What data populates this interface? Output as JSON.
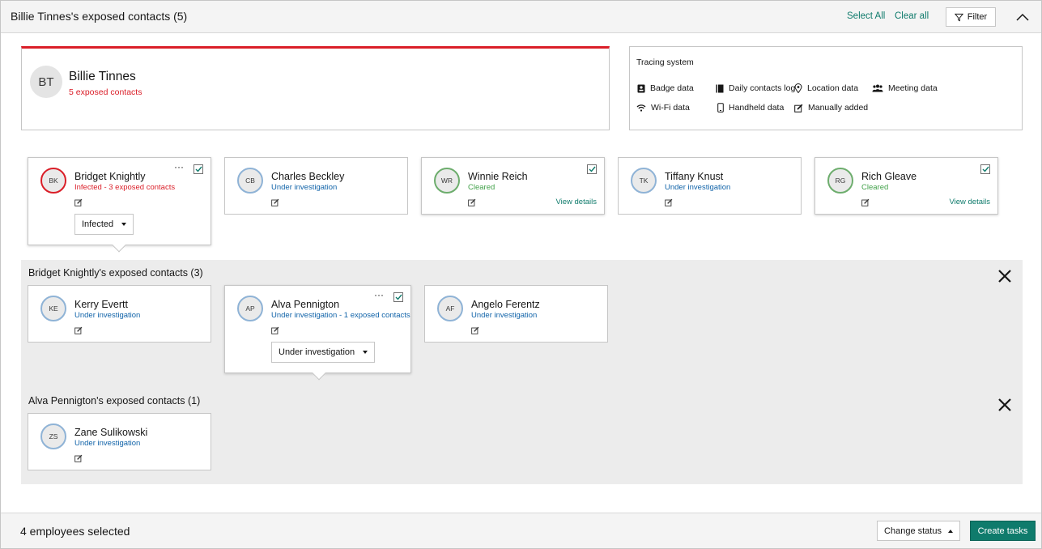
{
  "header": {
    "title": "Billie Tinnes's exposed contacts (5)",
    "select_all": "Select All",
    "clear_all": "Clear all",
    "filter": "Filter"
  },
  "person": {
    "initials": "BT",
    "name": "Billie Tinnes",
    "subtitle": "5 exposed contacts"
  },
  "tracing": {
    "title": "Tracing system",
    "items": [
      {
        "label": "Badge data",
        "icon": "badge-icon"
      },
      {
        "label": "Daily contacts log",
        "icon": "book-icon"
      },
      {
        "label": "Location data",
        "icon": "location-pin-icon"
      },
      {
        "label": "Meeting data",
        "icon": "people-icon"
      },
      {
        "label": "Wi-Fi data",
        "icon": "wifi-icon"
      },
      {
        "label": "Handheld data",
        "icon": "phone-icon"
      },
      {
        "label": "Manually added",
        "icon": "edit-icon"
      }
    ]
  },
  "contacts": [
    {
      "initials": "BK",
      "name": "Bridget Knightly",
      "status": "Infected - 3 exposed contacts",
      "status_type": "infected",
      "checked": true,
      "dropdown": "Infected"
    },
    {
      "initials": "CB",
      "name": "Charles Beckley",
      "status": "Under investigation",
      "status_type": "investigation",
      "checked": false
    },
    {
      "initials": "WR",
      "name": "Winnie Reich",
      "status": "Cleared",
      "status_type": "cleared",
      "checked": true,
      "view_details": "View details"
    },
    {
      "initials": "TK",
      "name": "Tiffany Knust",
      "status": "Under investigation",
      "status_type": "investigation",
      "checked": false
    },
    {
      "initials": "RG",
      "name": "Rich Gleave",
      "status": "Cleared",
      "status_type": "cleared",
      "checked": true,
      "view_details": "View details"
    }
  ],
  "panels": [
    {
      "title": "Bridget Knightly's exposed contacts (3)",
      "contacts": [
        {
          "initials": "KE",
          "name": "Kerry Evertt",
          "status": "Under investigation",
          "status_type": "investigation",
          "checked": false
        },
        {
          "initials": "AP",
          "name": "Alva Pennigton",
          "status": "Under investigation - 1 exposed contacts",
          "status_type": "investigation",
          "checked": true,
          "dropdown": "Under investigation"
        },
        {
          "initials": "AF",
          "name": "Angelo Ferentz",
          "status": "Under investigation",
          "status_type": "investigation",
          "checked": false
        }
      ]
    },
    {
      "title": "Alva Pennigton's exposed contacts (1)",
      "contacts": [
        {
          "initials": "ZS",
          "name": "Zane Sulikowski",
          "status": "Under investigation",
          "status_type": "investigation",
          "checked": false
        }
      ]
    }
  ],
  "footer": {
    "selected_text": "4 employees selected",
    "change_status": "Change status",
    "create_tasks": "Create tasks"
  },
  "colors": {
    "accent": "#0f7b6c",
    "infected": "#da1e28",
    "investigation": "#0f62a8",
    "cleared": "#42a14a"
  }
}
